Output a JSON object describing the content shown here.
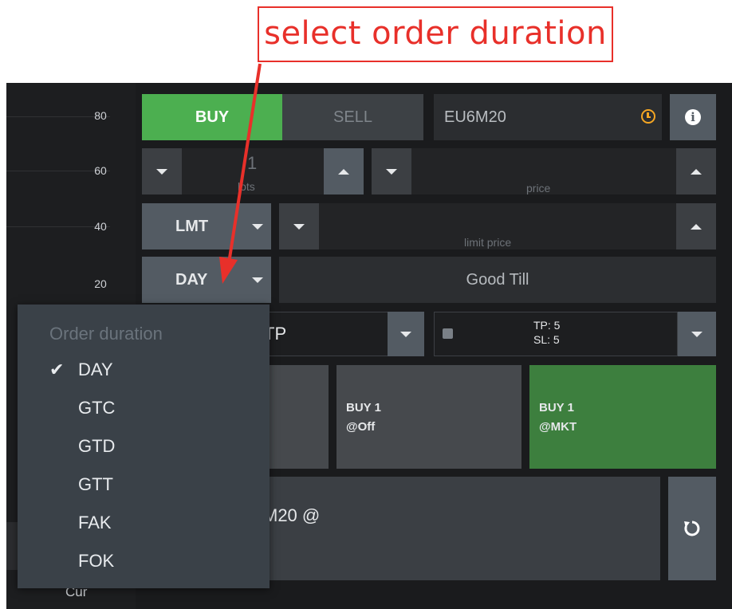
{
  "annotation": {
    "text": "select order duration"
  },
  "axis": {
    "ticks": [
      "80",
      "60",
      "40",
      "20"
    ],
    "bottom_label": "Cur"
  },
  "side": {
    "tabs": {
      "buy": "BUY",
      "sell": "SELL"
    }
  },
  "symbol": {
    "value": "EU6M20"
  },
  "quantity": {
    "value": "1",
    "label": "lots"
  },
  "price": {
    "label": "price"
  },
  "order_type": {
    "value": "LMT"
  },
  "limit_price": {
    "label": "limit price"
  },
  "duration": {
    "value": "DAY",
    "good_till_label": "Good Till"
  },
  "duration_menu": {
    "header": "Order duration",
    "items": [
      {
        "label": "DAY",
        "checked": true
      },
      {
        "label": "GTC",
        "checked": false
      },
      {
        "label": "GTD",
        "checked": false
      },
      {
        "label": "GTT",
        "checked": false
      },
      {
        "label": "FAK",
        "checked": false
      },
      {
        "label": "FOK",
        "checked": false
      }
    ]
  },
  "bracket": {
    "value": "TP",
    "tp": "TP: 5",
    "sl": "SL: 5"
  },
  "order_buttons": [
    {
      "line1": "BUY 1",
      "line2": "@Off",
      "color": "#46494d"
    },
    {
      "line1": "BUY 1",
      "line2": "@MKT",
      "color": "#3d7f3e"
    }
  ],
  "summary": {
    "text": "M20 @"
  },
  "colors": {
    "buy": "#4caf50",
    "market_button": "#3d7f3e",
    "annotation": "#e8302a",
    "clock": "#f5a623"
  }
}
